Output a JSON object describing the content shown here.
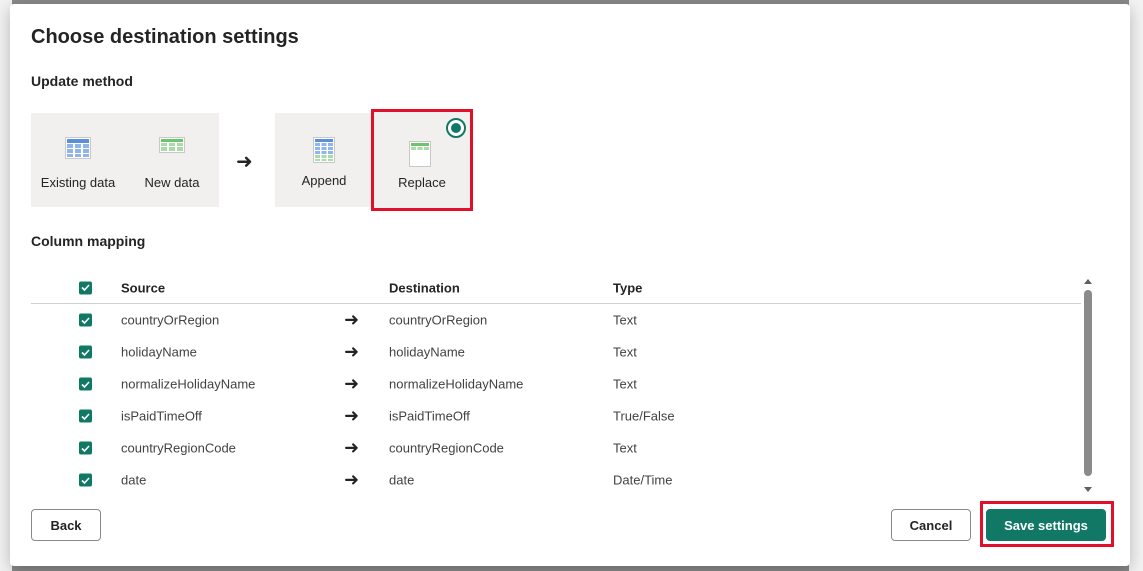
{
  "dialog": {
    "title": "Choose destination settings",
    "update_method_label": "Update method",
    "column_mapping_label": "Column mapping"
  },
  "update_method": {
    "existing_data_label": "Existing data",
    "new_data_label": "New data",
    "append_label": "Append",
    "replace_label": "Replace",
    "selected": "Replace"
  },
  "table": {
    "headers": {
      "source": "Source",
      "destination": "Destination",
      "type": "Type"
    },
    "rows": [
      {
        "source": "countryOrRegion",
        "destination": "countryOrRegion",
        "type": "Text",
        "checked": true
      },
      {
        "source": "holidayName",
        "destination": "holidayName",
        "type": "Text",
        "checked": true
      },
      {
        "source": "normalizeHolidayName",
        "destination": "normalizeHolidayName",
        "type": "Text",
        "checked": true
      },
      {
        "source": "isPaidTimeOff",
        "destination": "isPaidTimeOff",
        "type": "True/False",
        "checked": true
      },
      {
        "source": "countryRegionCode",
        "destination": "countryRegionCode",
        "type": "Text",
        "checked": true
      },
      {
        "source": "date",
        "destination": "date",
        "type": "Date/Time",
        "checked": true
      }
    ]
  },
  "buttons": {
    "back": "Back",
    "cancel": "Cancel",
    "save": "Save settings"
  },
  "colors": {
    "accent": "#117865",
    "highlight": "#e0102a"
  },
  "icons": {
    "arrow": "right-arrow-icon",
    "checkbox": "checkmark-icon"
  }
}
